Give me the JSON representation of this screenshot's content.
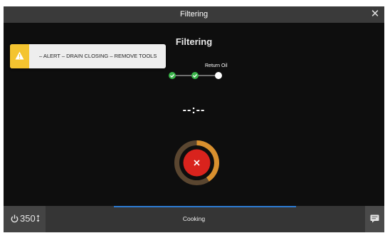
{
  "window": {
    "title": "Filtering",
    "close_icon": "close-icon"
  },
  "main": {
    "heading": "Filtering",
    "timer": "--:--"
  },
  "alert": {
    "icon": "warning-icon",
    "text": "– ALERT – DRAIN CLOSING – REMOVE TOOLS",
    "color": "#f4c430"
  },
  "stepper": {
    "current_label": "Return Oil",
    "steps": [
      {
        "state": "complete",
        "icon": "check-icon"
      },
      {
        "state": "complete",
        "icon": "check-icon"
      },
      {
        "state": "current"
      }
    ],
    "complete_color": "#3ab54a"
  },
  "dial": {
    "icon": "cancel-icon",
    "button_color": "#d9231d",
    "ring_color": "#d9902e"
  },
  "bottom_bar": {
    "power_icon": "power-icon",
    "temperature": "350",
    "temperature_icon": "temperature-arrows-icon",
    "mode_label": "Cooking",
    "progress_color": "#2d7bd3",
    "right_icon": "chat-icon"
  }
}
